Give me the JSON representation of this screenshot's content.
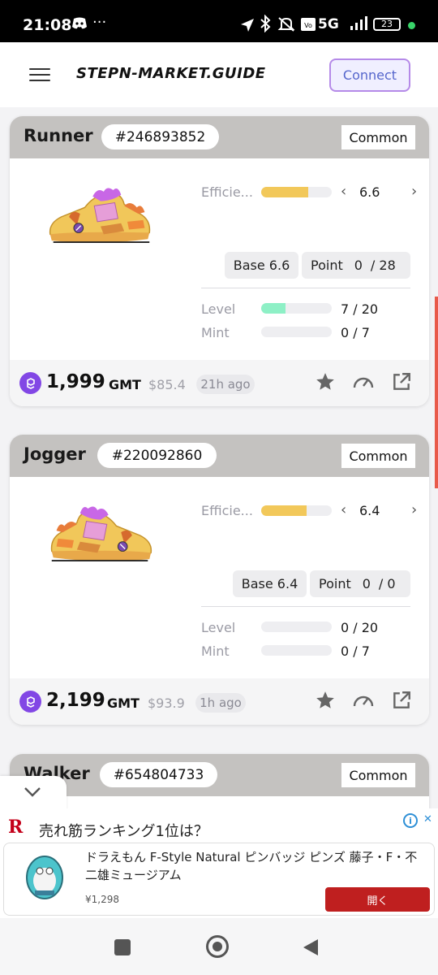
{
  "status_bar": {
    "time": "21:08",
    "network": "5G",
    "battery": "23",
    "icons": [
      "discord-icon",
      "more-dots-icon",
      "location-icon",
      "bluetooth-icon",
      "mute-icon",
      "volte-icon",
      "signal-icon",
      "battery-icon"
    ]
  },
  "header": {
    "brand": "STEPN-MARKET.GUIDE",
    "connect_label": "Connect"
  },
  "cards": [
    {
      "type": "Runner",
      "id": "#246893852",
      "rarity": "Common",
      "efficiency_label": "Efficie...",
      "efficiency_value": "6.6",
      "efficiency_fill": 0.67,
      "base_label": "Base 6.6",
      "point_label": "Point",
      "point_value": "0",
      "point_max": "/ 28",
      "level_label": "Level",
      "level_value": "7 / 20",
      "level_fill": 0.35,
      "mint_label": "Mint",
      "mint_value": "0 / 7",
      "mint_fill": 0,
      "price": "1,999",
      "unit": "GMT",
      "usd": "$85.4",
      "ago": "21h ago"
    },
    {
      "type": "Jogger",
      "id": "#220092860",
      "rarity": "Common",
      "efficiency_label": "Efficie...",
      "efficiency_value": "6.4",
      "efficiency_fill": 0.64,
      "base_label": "Base 6.4",
      "point_label": "Point",
      "point_value": "0",
      "point_max": "/ 0",
      "level_label": "Level",
      "level_value": "0 / 20",
      "level_fill": 0,
      "mint_label": "Mint",
      "mint_value": "0 / 7",
      "mint_fill": 0,
      "price": "2,199",
      "unit": "GMT",
      "usd": "$93.9",
      "ago": "1h ago"
    },
    {
      "type": "Walker",
      "id": "#654804733",
      "rarity": "Common"
    }
  ],
  "colors": {
    "efficiency": "#f2c85a",
    "level": "#8ef0c6",
    "gmt": "#8247e5"
  },
  "ad": {
    "headline": "売れ筋ランキング1位は？",
    "product": "ドラえもん F-Style Natural ピンバッジ ピンズ 藤子・F・不二雄ミュージアム",
    "price": "¥1,298",
    "cta": "開く"
  }
}
